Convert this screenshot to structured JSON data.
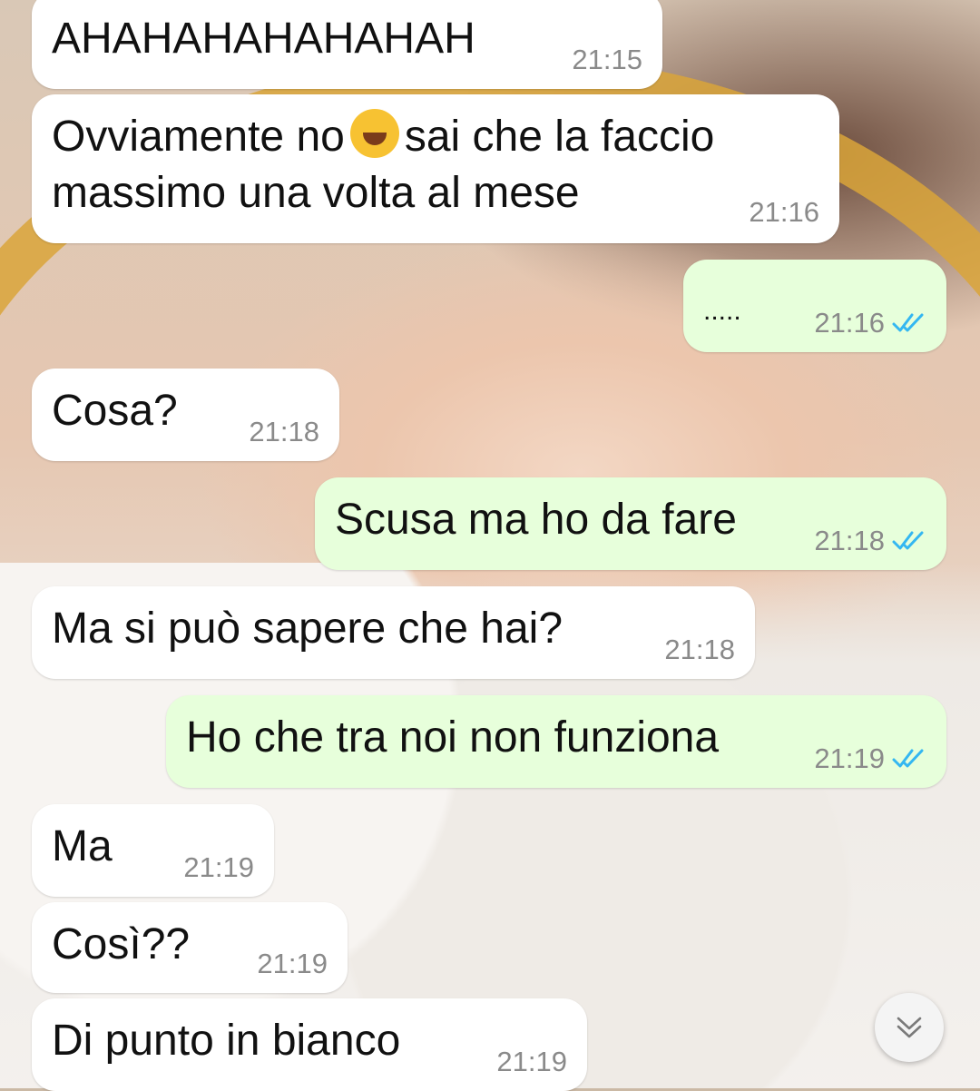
{
  "chat": {
    "messages": [
      {
        "dir": "in",
        "text": "AHAHAHAHAHAHAH",
        "time": "21:15"
      },
      {
        "dir": "in",
        "text_line1_a": "Ovviamente no",
        "emoji": "rolling-on-floor-laughing",
        "text_line1_b": "sai che la faccio",
        "text_line2": "massimo una volta al mese",
        "time": "21:16"
      },
      {
        "dir": "out",
        "text": ".....",
        "time": "21:16",
        "status": "read"
      },
      {
        "dir": "in",
        "text": "Cosa?",
        "time": "21:18"
      },
      {
        "dir": "out",
        "text": "Scusa ma ho da fare",
        "time": "21:18",
        "status": "read"
      },
      {
        "dir": "in",
        "text": "Ma si può sapere che hai?",
        "time": "21:18"
      },
      {
        "dir": "out",
        "text": "Ho che tra noi non funziona",
        "time": "21:19",
        "status": "read"
      },
      {
        "dir": "in",
        "text": "Ma",
        "time": "21:19"
      },
      {
        "dir": "in",
        "text": "Così??",
        "time": "21:19"
      },
      {
        "dir": "in",
        "text": "Di punto in bianco",
        "time": "21:19"
      }
    ]
  },
  "colors": {
    "incoming_bubble": "#ffffff",
    "outgoing_bubble": "#e7ffdb",
    "read_ticks": "#34b7f1",
    "timestamp": "#8a8a8a"
  },
  "icons": {
    "scroll_down": "chevron-down-icon",
    "read_receipt": "double-check-icon"
  }
}
